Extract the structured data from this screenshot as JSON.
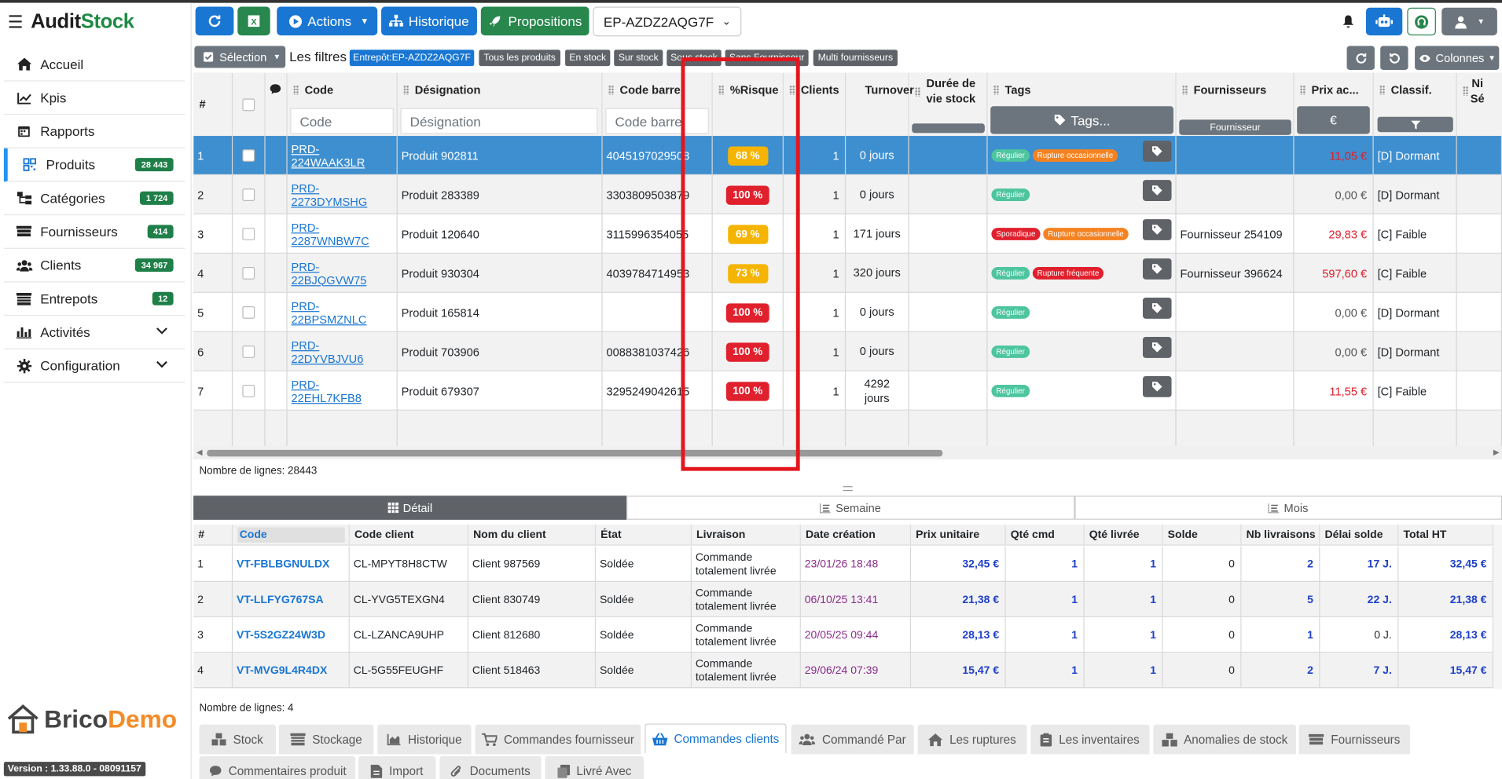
{
  "app": {
    "brand_a": "Audit",
    "brand_b": "Stock",
    "version": "Version : 1.33.88.0 - 08091157",
    "logo_a": "Brico",
    "logo_b": "Demo"
  },
  "sidebar": {
    "items": [
      {
        "label": "Accueil",
        "icon": "home-icon"
      },
      {
        "label": "Kpis",
        "icon": "chart-line-icon"
      },
      {
        "label": "Rapports",
        "icon": "calendar-icon"
      },
      {
        "label": "Produits",
        "icon": "qrcode-icon",
        "count": "28 443",
        "active": true
      },
      {
        "label": "Catégories",
        "icon": "sitemap-icon",
        "count": "1 724"
      },
      {
        "label": "Fournisseurs",
        "icon": "truck-icon",
        "count": "414"
      },
      {
        "label": "Clients",
        "icon": "users-icon",
        "count": "34 967"
      },
      {
        "label": "Entrepots",
        "icon": "warehouse-icon",
        "count": "12"
      },
      {
        "label": "Activités",
        "icon": "activity-icon",
        "chevron": true
      },
      {
        "label": "Configuration",
        "icon": "gear-icon",
        "chevron": true
      }
    ]
  },
  "toolbar": {
    "actions": "Actions",
    "historique": "Historique",
    "propositions": "Propositions",
    "entrepot": "EP-AZDZ2AQG7F"
  },
  "filters": {
    "selection": "Sélection",
    "label": "Les filtres",
    "chips": [
      {
        "label": "Entrepôt:EP-AZDZ2AQG7F",
        "active": true
      },
      {
        "label": "Tous les produits"
      },
      {
        "label": "En stock"
      },
      {
        "label": "Sur stock"
      },
      {
        "label": "Sous stock"
      },
      {
        "label": "Sans Fournisseur"
      },
      {
        "label": "Multi fournisseurs"
      }
    ],
    "columns": "Colonnes"
  },
  "grid": {
    "headers": {
      "num": "#",
      "code": "Code",
      "designation": "Désignation",
      "barcode": "Code barre",
      "risk": "%Risque",
      "clients": "Clients",
      "turnover": "Turnover",
      "duree1": "Durée de",
      "duree2": "vie stock",
      "tags": "Tags",
      "fournisseurs": "Fournisseurs",
      "prix": "Prix ac...",
      "classif": "Classif.",
      "ni1": "Ni",
      "ni2": "Sé"
    },
    "filter_placeholders": {
      "code": "Code",
      "designation": "Désignation",
      "barcode": "Code barre",
      "tags": "Tags...",
      "fournisseur": "Fournisseur",
      "prix": "€"
    },
    "rows": [
      {
        "num": "1",
        "code": "PRD-224WAAK3LR",
        "designation": "Produit 902811",
        "barcode": "4045197029508",
        "risk": "68 %",
        "risk_level": "y",
        "clients": "1",
        "turnover": "0 jours",
        "tags": [
          {
            "label": "Régulier",
            "color": "green"
          },
          {
            "label": "Rupture occasionnelle",
            "color": "orange"
          }
        ],
        "fournisseur": "",
        "prix": "11,05 €",
        "prix_color": "red",
        "classif": "[D] Dormant",
        "selected": true
      },
      {
        "num": "2",
        "code": "PRD-2273DYMSHG",
        "designation": "Produit 283389",
        "barcode": "3303809503879",
        "risk": "100 %",
        "risk_level": "r",
        "clients": "1",
        "turnover": "0 jours",
        "tags": [
          {
            "label": "Régulier",
            "color": "green"
          }
        ],
        "fournisseur": "",
        "prix": "0,00 €",
        "prix_color": "gray",
        "classif": "[D] Dormant"
      },
      {
        "num": "3",
        "code": "PRD-2287WNBW7C",
        "designation": "Produit 120640",
        "barcode": "3115996354055",
        "risk": "69 %",
        "risk_level": "y",
        "clients": "1",
        "turnover": "171 jours",
        "tags": [
          {
            "label": "Sporadique",
            "color": "red"
          },
          {
            "label": "Rupture occasionnelle",
            "color": "orange"
          }
        ],
        "fournisseur": "Fournisseur 254109",
        "prix": "29,83 €",
        "prix_color": "red",
        "classif": "[C] Faible"
      },
      {
        "num": "4",
        "code": "PRD-22BJQGVW75",
        "designation": "Produit 930304",
        "barcode": "4039784714953",
        "risk": "73 %",
        "risk_level": "y",
        "clients": "1",
        "turnover": "320 jours",
        "tags": [
          {
            "label": "Régulier",
            "color": "green"
          },
          {
            "label": "Rupture fréquente",
            "color": "red"
          }
        ],
        "fournisseur": "Fournisseur 396624",
        "prix": "597,60 €",
        "prix_color": "red",
        "classif": "[C] Faible"
      },
      {
        "num": "5",
        "code": "PRD-22BPSMZNLC",
        "designation": "Produit 165814",
        "barcode": "",
        "risk": "100 %",
        "risk_level": "r",
        "clients": "1",
        "turnover": "0 jours",
        "tags": [
          {
            "label": "Régulier",
            "color": "green"
          }
        ],
        "fournisseur": "",
        "prix": "0,00 €",
        "prix_color": "gray",
        "classif": "[D] Dormant"
      },
      {
        "num": "6",
        "code": "PRD-22DYVBJVU6",
        "designation": "Produit 703906",
        "barcode": "0088381037426",
        "risk": "100 %",
        "risk_level": "r",
        "clients": "1",
        "turnover": "0 jours",
        "tags": [
          {
            "label": "Régulier",
            "color": "green"
          }
        ],
        "fournisseur": "",
        "prix": "0,00 €",
        "prix_color": "gray",
        "classif": "[D] Dormant"
      },
      {
        "num": "7",
        "code": "PRD-22EHL7KFB8",
        "designation": "Produit 679307",
        "barcode": "3295249042615",
        "risk": "100 %",
        "risk_level": "r",
        "clients": "1",
        "turnover": "4292 jours",
        "tags": [
          {
            "label": "Régulier",
            "color": "green"
          }
        ],
        "fournisseur": "",
        "prix": "11,55 €",
        "prix_color": "red",
        "classif": "[C] Faible"
      }
    ],
    "row_count": "Nombre de lignes: 28443"
  },
  "lower_tabs": [
    {
      "label": "Détail",
      "active": true
    },
    {
      "label": "Semaine"
    },
    {
      "label": "Mois"
    }
  ],
  "lower_table": {
    "headers": [
      "#",
      "Code",
      "Code client",
      "Nom du client",
      "État",
      "Livraison",
      "Date création",
      "Prix unitaire",
      "Qté cmd",
      "Qté livrée",
      "Solde",
      "Nb livraisons",
      "Délai solde",
      "Total HT"
    ],
    "rows": [
      {
        "num": "1",
        "code": "VT-FBLBGNULDX",
        "client_code": "CL-MPYT8H8CTW",
        "client": "Client 987569",
        "etat": "Soldée",
        "livraison": "Commande totalement livrée",
        "date": "23/01/26 18:48",
        "prix": "32,45 €",
        "qcmd": "1",
        "qliv": "1",
        "solde": "0",
        "nbliv": "2",
        "delai": "17 J.",
        "total": "32,45 €"
      },
      {
        "num": "2",
        "code": "VT-LLFYG767SA",
        "client_code": "CL-YVG5TEXGN4",
        "client": "Client 830749",
        "etat": "Soldée",
        "livraison": "Commande totalement livrée",
        "date": "06/10/25 13:41",
        "prix": "21,38 €",
        "qcmd": "1",
        "qliv": "1",
        "solde": "0",
        "nbliv": "5",
        "delai": "22 J.",
        "total": "21,38 €"
      },
      {
        "num": "3",
        "code": "VT-5S2GZ24W3D",
        "client_code": "CL-LZANCA9UHP",
        "client": "Client 812680",
        "etat": "Soldée",
        "livraison": "Commande totalement livrée",
        "date": "20/05/25 09:44",
        "prix": "28,13 €",
        "qcmd": "1",
        "qliv": "1",
        "solde": "0",
        "nbliv": "1",
        "delai": "0 J.",
        "total": "28,13 €"
      },
      {
        "num": "4",
        "code": "VT-MVG9L4R4DX",
        "client_code": "CL-5G55FEUGHF",
        "client": "Client 518463",
        "etat": "Soldée",
        "livraison": "Commande totalement livrée",
        "date": "29/06/24 07:39",
        "prix": "15,47 €",
        "qcmd": "1",
        "qliv": "1",
        "solde": "0",
        "nbliv": "2",
        "delai": "7 J.",
        "total": "15,47 €"
      }
    ],
    "row_count": "Nombre de lignes: 4"
  },
  "bottom_tabs": [
    {
      "label": "Stock",
      "icon": "boxes-icon"
    },
    {
      "label": "Stockage",
      "icon": "warehouse-icon"
    },
    {
      "label": "Historique",
      "icon": "chart-area-icon"
    },
    {
      "label": "Commandes fournisseur",
      "icon": "cart-icon"
    },
    {
      "label": "Commandes clients",
      "icon": "basket-icon",
      "active": true
    },
    {
      "label": "Commandé Par",
      "icon": "users-icon"
    },
    {
      "label": "Les ruptures",
      "icon": "home-icon"
    },
    {
      "label": "Les inventaires",
      "icon": "clipboard-icon"
    },
    {
      "label": "Anomalies de stock",
      "icon": "cubes-icon"
    },
    {
      "label": "Fournisseurs",
      "icon": "truck-icon"
    },
    {
      "label": "Commentaires produit",
      "icon": "comment-icon"
    },
    {
      "label": "Import",
      "icon": "file-icon"
    },
    {
      "label": "Documents",
      "icon": "paperclip-icon"
    },
    {
      "label": "Livré Avec",
      "icon": "copy-icon"
    }
  ],
  "colors": {
    "primary": "#1976d2",
    "success": "#27874d",
    "danger": "#e0202d",
    "warning": "#f5b400",
    "highlight_box": "#e3161e"
  }
}
